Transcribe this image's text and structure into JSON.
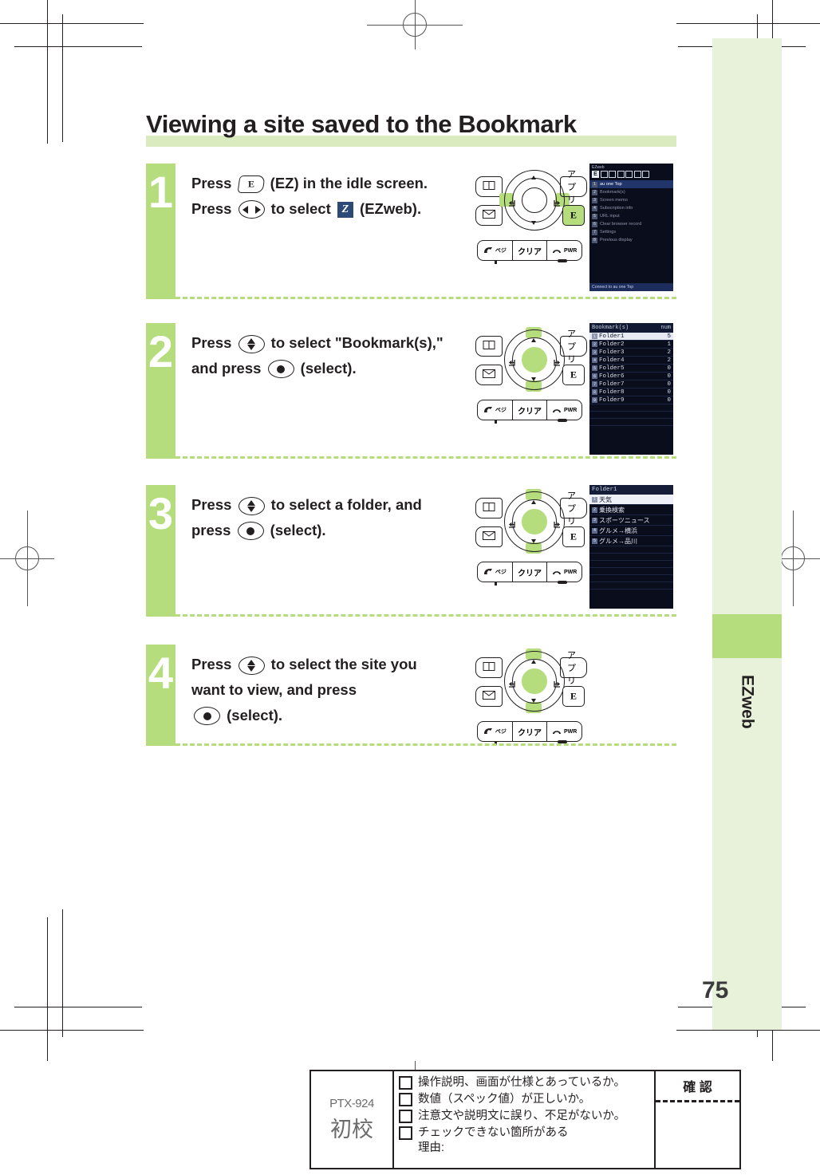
{
  "document": {
    "title": "Viewing a site saved to the Bookmark",
    "page_number": "75",
    "sidebar_tab_label": "EZweb",
    "accent_green": "#b5dd7e",
    "pale_green": "#e8f2da"
  },
  "steps": [
    {
      "number": "1",
      "lines": [
        {
          "pre": "Press ",
          "key": "ez-key",
          "mid": " (EZ) in the idle screen.",
          "post": ""
        },
        {
          "pre": "Press ",
          "key": "left-right-key",
          "mid": " to select ",
          "icon": "ezweb-icon",
          "post": " (EZweb)."
        }
      ],
      "keypad": {
        "left_top_icon": "book-icon",
        "left_bottom_icon": "mail-icon",
        "right_top_label": "アプリ",
        "right_bottom_label": "E",
        "highlight": "left-right",
        "bottom_keys": [
          "ペジ",
          "クリア",
          "PWR"
        ]
      },
      "screen": {
        "type": "menu",
        "header": "EZweb",
        "status_icons": [
          "E",
          "mail",
          "music",
          "camera",
          "cart",
          "battery",
          "antenna"
        ],
        "items": [
          {
            "num": "1",
            "label": "au one Top",
            "selected": true
          },
          {
            "num": "2",
            "label": "Bookmark(s)",
            "selected": false
          },
          {
            "num": "3",
            "label": "Screen memo",
            "selected": false
          },
          {
            "num": "4",
            "label": "Subscription info",
            "selected": false
          },
          {
            "num": "5",
            "label": "URL input",
            "selected": false
          },
          {
            "num": "6",
            "label": "Clear browser record",
            "selected": false
          },
          {
            "num": "7",
            "label": "Settings",
            "selected": false
          },
          {
            "num": "8",
            "label": "Previous display",
            "selected": false
          }
        ],
        "footer": "Connect to au one Top"
      }
    },
    {
      "number": "2",
      "lines": [
        {
          "pre": "Press ",
          "key": "up-down-key",
          "mid": " to select \"Bookmark(s),\"",
          "post": ""
        },
        {
          "pre": "and press ",
          "key": "select-key",
          "mid": " (select).",
          "post": ""
        }
      ],
      "keypad": {
        "left_top_icon": "book-icon",
        "left_bottom_icon": "mail-icon",
        "right_top_label": "アプリ",
        "right_bottom_label": "E",
        "highlight": "up-down-center",
        "bottom_keys": [
          "ペジ",
          "クリア",
          "PWR"
        ]
      },
      "screen": {
        "type": "bookmark-list",
        "title": "Bookmark(s)",
        "count_header": "num",
        "rows": [
          {
            "label": "Folder1",
            "count": "5",
            "selected": true
          },
          {
            "label": "Folder2",
            "count": "1",
            "selected": false
          },
          {
            "label": "Folder3",
            "count": "2",
            "selected": false
          },
          {
            "label": "Folder4",
            "count": "2",
            "selected": false
          },
          {
            "label": "Folder5",
            "count": "0",
            "selected": false
          },
          {
            "label": "Folder6",
            "count": "0",
            "selected": false
          },
          {
            "label": "Folder7",
            "count": "0",
            "selected": false
          },
          {
            "label": "Folder8",
            "count": "0",
            "selected": false
          },
          {
            "label": "Folder9",
            "count": "0",
            "selected": false
          }
        ]
      }
    },
    {
      "number": "3",
      "lines": [
        {
          "pre": "Press ",
          "key": "up-down-key",
          "mid": " to select a folder, and",
          "post": ""
        },
        {
          "pre": "press ",
          "key": "select-key",
          "mid": " (select).",
          "post": ""
        }
      ],
      "keypad": {
        "left_top_icon": "book-icon",
        "left_bottom_icon": "mail-icon",
        "right_top_label": "アプリ",
        "right_bottom_label": "E",
        "highlight": "up-down-center",
        "bottom_keys": [
          "ペジ",
          "クリア",
          "PWR"
        ]
      },
      "screen": {
        "type": "folder-list",
        "title": "Folder1",
        "rows": [
          {
            "num": "1",
            "label": "天気",
            "selected": true
          },
          {
            "num": "2",
            "label": "乗換検索",
            "selected": false
          },
          {
            "num": "3",
            "label": "スポーツニュース",
            "selected": false
          },
          {
            "num": "4",
            "label": "グルメ→横浜",
            "selected": false
          },
          {
            "num": "5",
            "label": "グルメ→品川",
            "selected": false
          }
        ]
      }
    },
    {
      "number": "4",
      "lines": [
        {
          "pre": "Press ",
          "key": "up-down-key",
          "mid": " to select the site you",
          "post": ""
        },
        {
          "pre": "want to view, and press",
          "key": "",
          "mid": "",
          "post": ""
        },
        {
          "pre": "",
          "key": "select-key",
          "mid": " (select).",
          "post": ""
        }
      ],
      "keypad": {
        "left_top_icon": "book-icon",
        "left_bottom_icon": "mail-icon",
        "right_top_label": "アプリ",
        "right_bottom_label": "E",
        "highlight": "up-down-center",
        "bottom_keys": [
          "ペジ",
          "クリア",
          "PWR"
        ]
      },
      "screen": null
    }
  ],
  "proof_block": {
    "code": "PTX-924",
    "stage": "初校",
    "checklist": [
      "操作説明、画面が仕様とあっているか。",
      "数値（スペック値）が正しいか。",
      "注意文や説明文に誤り、不足がないか。",
      "チェックできない箇所がある\n理由:"
    ],
    "confirm_label": "確 認"
  }
}
